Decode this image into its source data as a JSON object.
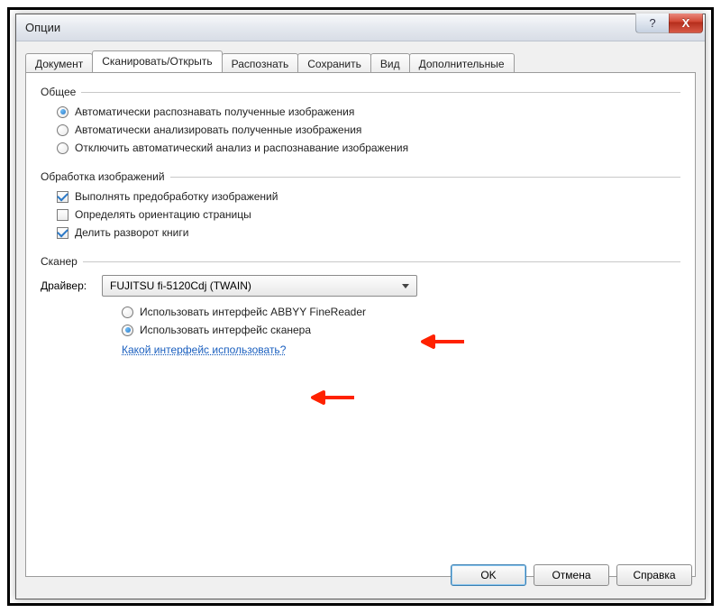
{
  "window": {
    "title": "Опции",
    "help_glyph": "?",
    "close_glyph": "X"
  },
  "tabs": [
    {
      "label": "Документ"
    },
    {
      "label": "Сканировать/Открыть"
    },
    {
      "label": "Распознать"
    },
    {
      "label": "Сохранить"
    },
    {
      "label": "Вид"
    },
    {
      "label": "Дополнительные"
    }
  ],
  "group_general": {
    "title": "Общее",
    "opt_auto_recognize": "Автоматически распознавать полученные изображения",
    "opt_auto_analyze": "Автоматически анализировать полученные изображения",
    "opt_disable_auto": "Отключить автоматический анализ и распознавание изображения"
  },
  "group_processing": {
    "title": "Обработка изображений",
    "chk_preprocess": "Выполнять предобработку изображений",
    "chk_orientation": "Определять ориентацию страницы",
    "chk_split_spread": "Делить разворот книги"
  },
  "group_scanner": {
    "title": "Сканер",
    "driver_label": "Драйвер:",
    "driver_value": "FUJITSU fi-5120Cdj (TWAIN)",
    "opt_abbyy_iface": "Использовать интерфейс ABBYY FineReader",
    "opt_scanner_iface": "Использовать интерфейс сканера",
    "help_link": "Какой интерфейс использовать?"
  },
  "buttons": {
    "ok": "OK",
    "cancel": "Отмена",
    "help": "Справка"
  }
}
